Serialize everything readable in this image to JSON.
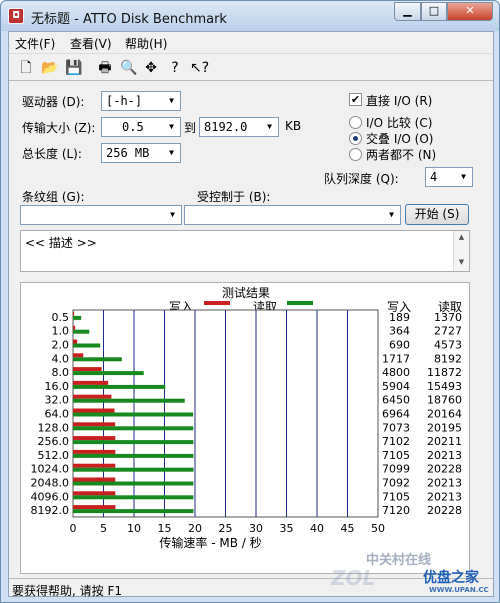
{
  "window": {
    "title": "无标题 - ATTO Disk Benchmark"
  },
  "menu": [
    "文件(F)",
    "查看(V)",
    "帮助(H)"
  ],
  "toolbar_icons": [
    "new-icon",
    "open-icon",
    "save-icon",
    "print-icon",
    "print-preview-icon",
    "move-icon",
    "help-icon",
    "context-help-icon"
  ],
  "form": {
    "drive_label": "驱动器 (D):",
    "drive_value": "[-h-]",
    "transfer_label": "传输大小 (Z):",
    "transfer_from": "0.5",
    "to_label": "到",
    "transfer_to": "8192.0",
    "kb_label": "KB",
    "length_label": "总长度 (L):",
    "length_value": "256 MB",
    "direct_io_label": "直接 I/O (R)",
    "io_compare_label": "I/O 比较 (C)",
    "overlap_io_label": "交叠 I/O (O)",
    "neither_label": "两者都不 (N)",
    "queue_label": "队列深度 (Q):",
    "queue_value": "4",
    "stripe_label": "条纹组 (G):",
    "controlled_label": "受控制于 (B):",
    "start_label": "开始 (S)",
    "desc_text": "<< 描述 >>"
  },
  "status": {
    "text": "要获得帮助, 请按 F1"
  },
  "watermark": {
    "text1": "中关村在线",
    "text2": "ZOL",
    "text3": "优盘之家",
    "text4": "WWW.UPAN.CC"
  },
  "chart_data": {
    "type": "bar",
    "orientation": "horizontal",
    "title": "测试结果",
    "xlabel": "传输速率 - MB / 秒",
    "xlim": [
      0,
      50
    ],
    "xticks": [
      0,
      5,
      10,
      15,
      20,
      25,
      30,
      35,
      40,
      45,
      50
    ],
    "categories": [
      "0.5",
      "1.0",
      "2.0",
      "4.0",
      "8.0",
      "16.0",
      "32.0",
      "64.0",
      "128.0",
      "256.0",
      "512.0",
      "1024.0",
      "2048.0",
      "4096.0",
      "8192.0"
    ],
    "series": [
      {
        "name": "写入",
        "color": "#c8201e",
        "values": [
          189,
          364,
          690,
          1717,
          4800,
          5904,
          6450,
          6964,
          7073,
          7102,
          7105,
          7099,
          7092,
          7105,
          7120
        ]
      },
      {
        "name": "读取",
        "color": "#178a1d",
        "values": [
          1370,
          2727,
          4573,
          8192,
          11872,
          15493,
          18760,
          20164,
          20195,
          20211,
          20213,
          20228,
          20213,
          20213,
          20228
        ]
      }
    ],
    "value_scale": "KB/s shown in columns; bars plotted in MB/s",
    "column_headers": [
      "写入",
      "读取"
    ]
  }
}
